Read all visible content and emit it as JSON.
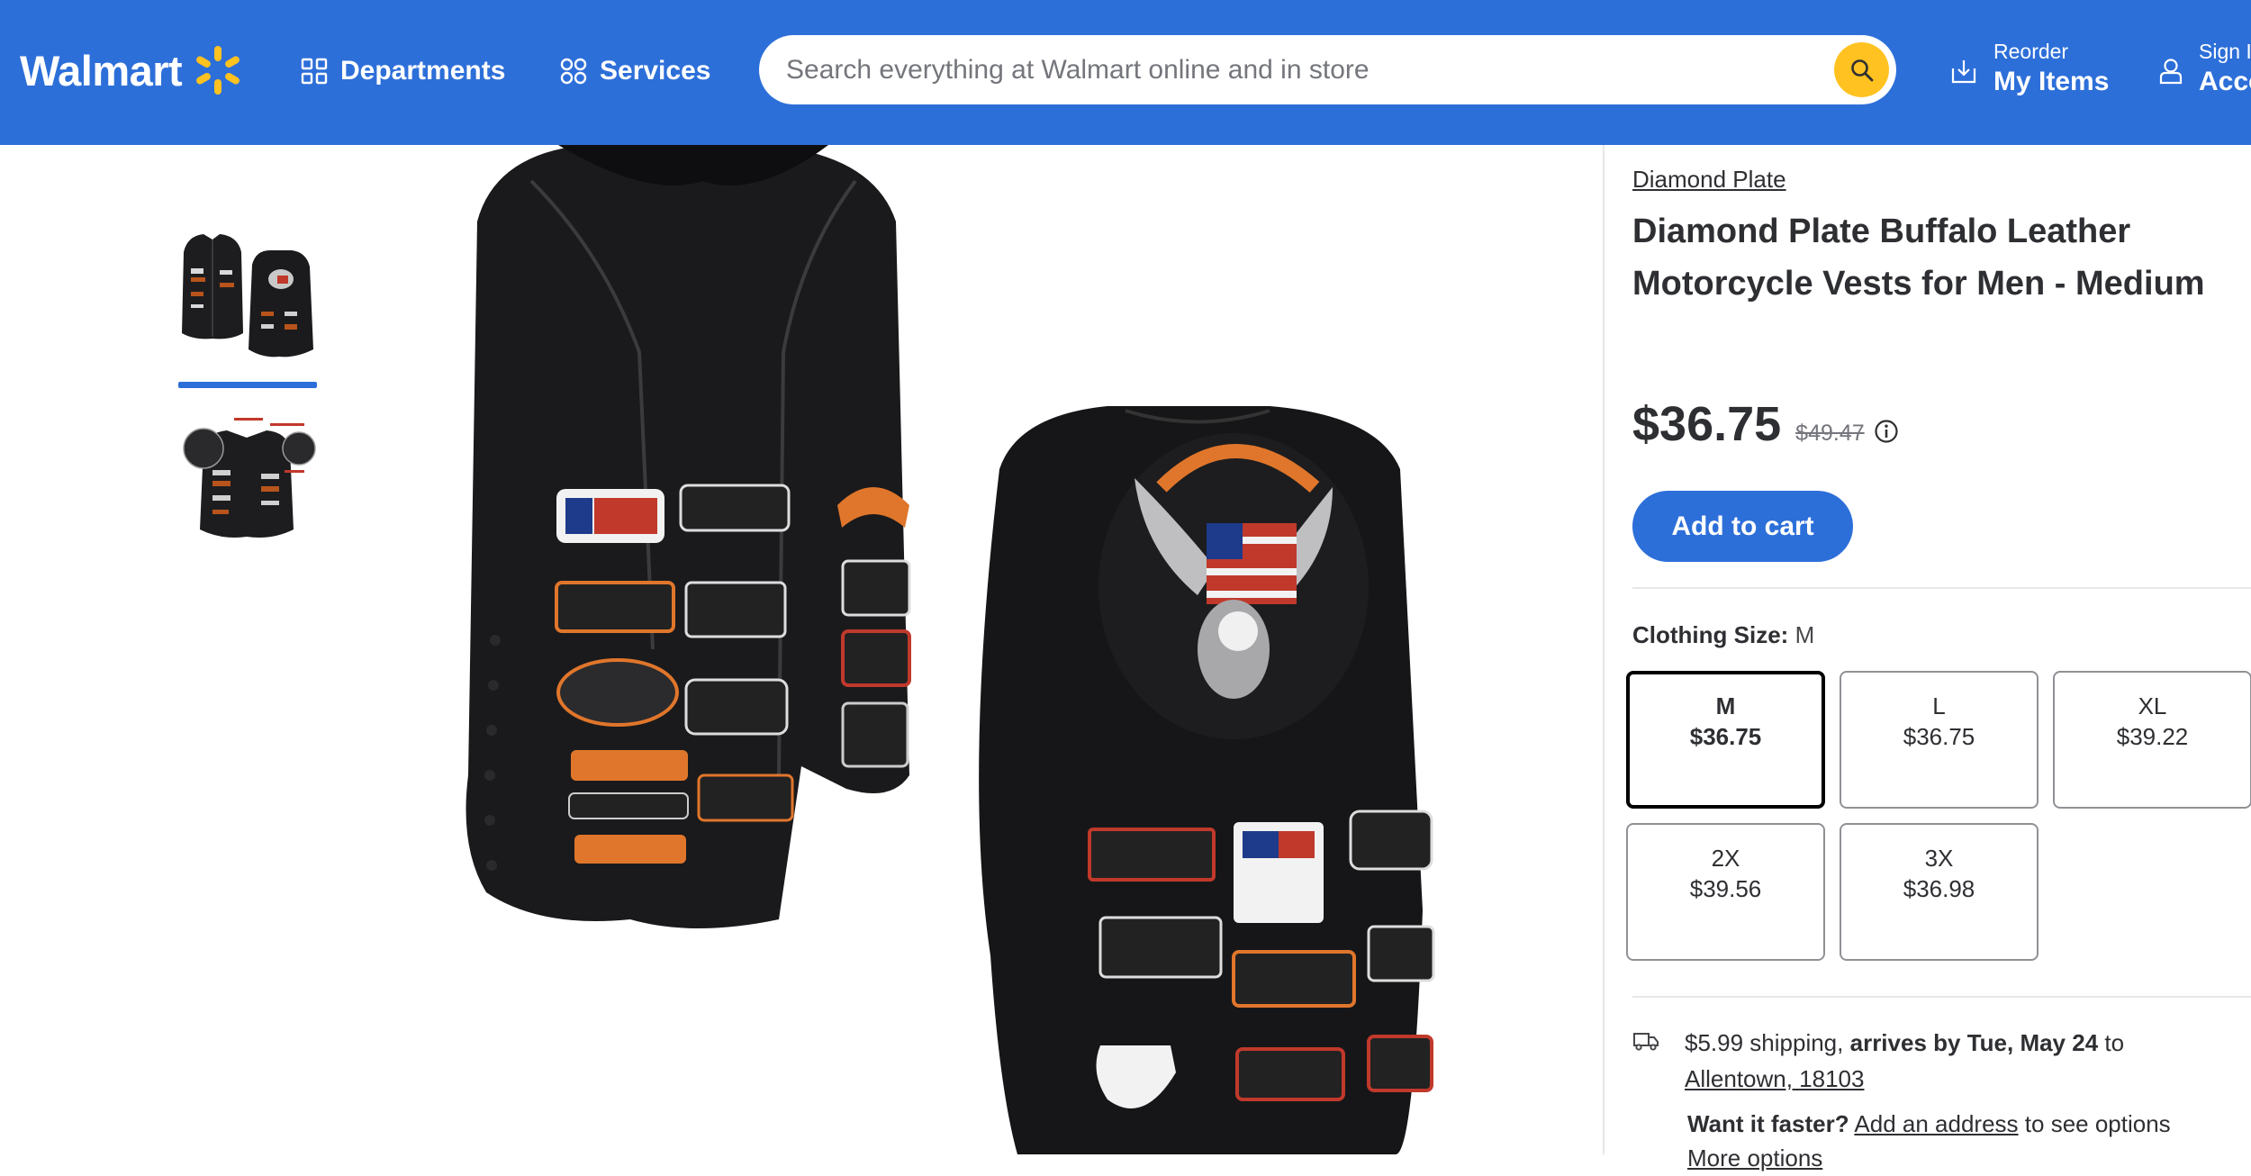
{
  "header": {
    "logo_text": "Walmart",
    "departments_label": "Departments",
    "services_label": "Services",
    "search_placeholder": "Search everything at Walmart online and in store",
    "reorder_small": "Reorder",
    "reorder_big": "My Items",
    "account_small": "Sign In",
    "account_big": "Account",
    "colors": {
      "brand_blue": "#2d6fd9",
      "spark_yellow": "#ffc220"
    }
  },
  "gallery": {
    "thumbnails": [
      "vest-front-and-back",
      "vest-with-interior-callouts"
    ],
    "selected_index": 0
  },
  "product": {
    "brand": "Diamond Plate",
    "title": "Diamond Plate Buffalo Leather Motorcycle Vests for Men - Medium",
    "price": "$36.75",
    "was_price": "$49.47",
    "add_to_cart_label": "Add to cart",
    "size_label": "Clothing Size:",
    "size_selected": "M",
    "sizes": [
      {
        "size": "M",
        "price": "$36.75",
        "selected": true
      },
      {
        "size": "L",
        "price": "$36.75",
        "selected": false
      },
      {
        "size": "XL",
        "price": "$39.22",
        "selected": false
      },
      {
        "size": "2X",
        "price": "$39.56",
        "selected": false
      },
      {
        "size": "3X",
        "price": "$36.98",
        "selected": false
      }
    ]
  },
  "shipping": {
    "cost": "$5.99 shipping,",
    "arrives": "arrives by Tue, May 24",
    "to": "to",
    "location": "Allentown, 18103",
    "want_faster": "Want it faster?",
    "add_address": "Add an address",
    "see_options": "to see options",
    "more_options": "More options"
  }
}
